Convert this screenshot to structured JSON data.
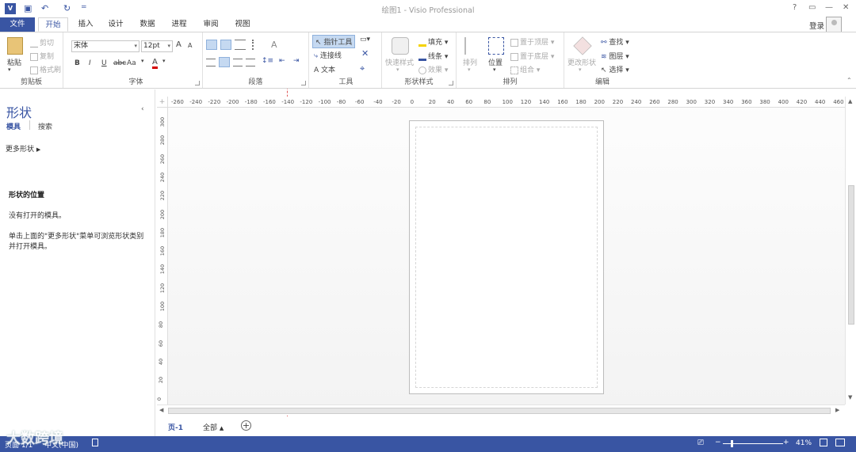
{
  "window": {
    "title": "绘图1 - Visio Professional",
    "help": "?",
    "restore": "▭",
    "minimize": "—",
    "maximize": "☐",
    "close": "✕"
  },
  "app_icon": "V",
  "qat": {
    "save_icon": "save-icon",
    "undo_icon": "undo-icon",
    "redo_icon": "redo-icon",
    "customize": "="
  },
  "tabs": [
    "文件",
    "开始",
    "插入",
    "设计",
    "数据",
    "进程",
    "审阅",
    "视图"
  ],
  "account": {
    "login": "登录"
  },
  "ribbon": {
    "clipboard": {
      "label": "剪贴板",
      "paste": "粘贴",
      "cut": "剪切",
      "copy": "复制",
      "format_painter": "格式刷"
    },
    "font": {
      "label": "字体",
      "font_name": "宋体",
      "font_size": "12pt",
      "grow": "A",
      "shrink": "A",
      "bold": "B",
      "italic": "I",
      "underline": "U",
      "strike": "abc",
      "case": "Aa",
      "color": "A"
    },
    "paragraph": {
      "label": "段落"
    },
    "tools": {
      "label": "工具",
      "pointer": "指针工具",
      "connector": "连接线",
      "text": "文本"
    },
    "shape_styles": {
      "label": "形状样式",
      "quick_styles": "快速样式",
      "fill": "填充",
      "line": "线条",
      "effects": "效果"
    },
    "arrange": {
      "label": "排列",
      "align": "排列",
      "position": "位置",
      "bring_front": "置于顶层",
      "send_back": "置于底层",
      "group": "组合"
    },
    "editing": {
      "label": "编辑",
      "change_shape": "更改形状",
      "find": "查找",
      "layers": "图层",
      "select": "选择"
    }
  },
  "shapes_pane": {
    "title": "形状",
    "tab_stencils": "模具",
    "tab_search": "搜索",
    "more_shapes": "更多形状",
    "location_heading": "形状的位置",
    "no_stencil": "没有打开的模具。",
    "hint_line1": "单击上面的\"更多形状\"菜单可浏览形状类别",
    "hint_line2": "并打开模具。"
  },
  "ruler": {
    "h": [
      "-260",
      "-240",
      "-220",
      "-200",
      "-180",
      "-160",
      "-140",
      "-120",
      "-100",
      "-80",
      "-60",
      "-40",
      "-20",
      "0",
      "20",
      "40",
      "60",
      "80",
      "100",
      "120",
      "140",
      "160",
      "180",
      "200",
      "220",
      "240",
      "260",
      "280",
      "300",
      "320",
      "340",
      "360",
      "380",
      "400",
      "420",
      "440",
      "460"
    ],
    "v": [
      "300",
      "280",
      "260",
      "240",
      "220",
      "200",
      "180",
      "160",
      "140",
      "120",
      "100",
      "80",
      "60",
      "40",
      "20",
      "0"
    ]
  },
  "page_tabs": {
    "page1": "页-1",
    "all": "全部"
  },
  "status": {
    "page": "页面 1/1",
    "lang": "中文(中国)",
    "zoom": "41%"
  },
  "watermark": "大数跨境"
}
